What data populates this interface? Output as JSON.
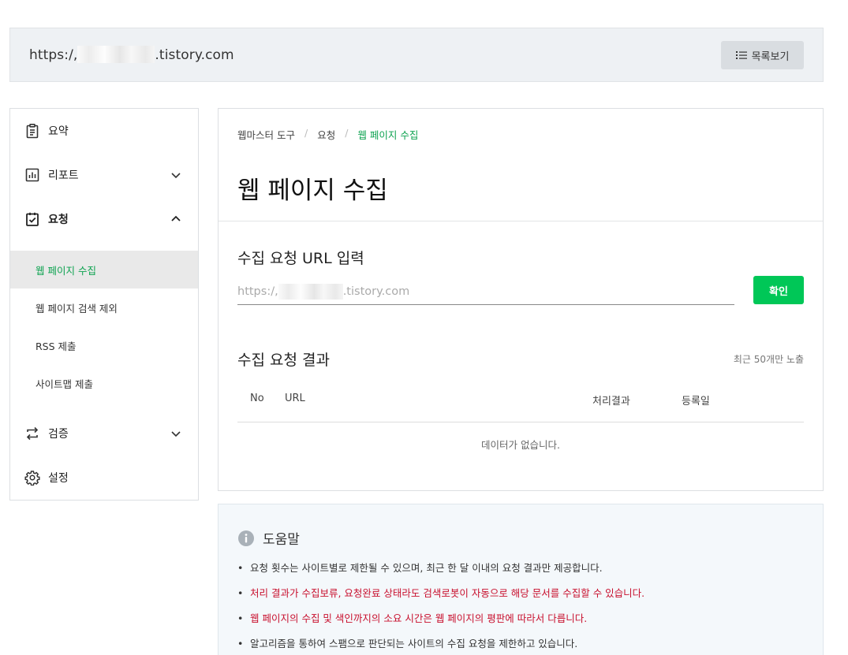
{
  "site": {
    "url_prefix": "https:/,",
    "url_suffix": ".tistory.com",
    "list_button": "목록보기"
  },
  "sidebar": {
    "items": [
      {
        "label": "요약",
        "icon": "clipboard-icon"
      },
      {
        "label": "리포트",
        "icon": "chart-icon"
      },
      {
        "label": "요청",
        "icon": "clipboard-check-icon"
      },
      {
        "label": "검증",
        "icon": "repeat-icon"
      },
      {
        "label": "설정",
        "icon": "gear-icon"
      }
    ],
    "sub_items": [
      {
        "label": "웹 페이지 수집"
      },
      {
        "label": "웹 페이지 검색 제외"
      },
      {
        "label": "RSS 제출"
      },
      {
        "label": "사이트맵 제출"
      }
    ]
  },
  "breadcrumb": [
    "웹마스터 도구",
    "요청",
    "웹 페이지 수집"
  ],
  "page_title": "웹 페이지 수집",
  "request": {
    "title": "수집 요청 URL 입력",
    "url_prefix": "https:/,",
    "url_suffix": ".tistory.com",
    "confirm_label": "확인"
  },
  "results": {
    "title": "수집 요청 결과",
    "note": "최근 50개만 노출",
    "columns": [
      "No",
      "URL",
      "처리결과",
      "등록일"
    ],
    "empty": "데이터가 없습니다."
  },
  "help": {
    "title": "도움말",
    "items": [
      {
        "text": "요청 횟수는 사이트별로 제한될 수 있으며, 최근 한 달 이내의 요청 결과만 제공합니다."
      },
      {
        "text": "처리 결과가 수집보류, 요청완료 상태라도 검색로봇이 자동으로 해당 문서를 수집할 수 있습니다."
      },
      {
        "text": "웹 페이지의 수집 및 색인까지의 소요 시간은 웹 페이지의 평판에 따라서 다릅니다."
      },
      {
        "text": "알고리즘을 통하여 스팸으로 판단되는 사이트의 수집 요청을 제한하고 있습니다."
      }
    ]
  },
  "colors": {
    "accent": "#00c757",
    "active_text": "#0ca24f",
    "warning_text": "#c8102e"
  }
}
